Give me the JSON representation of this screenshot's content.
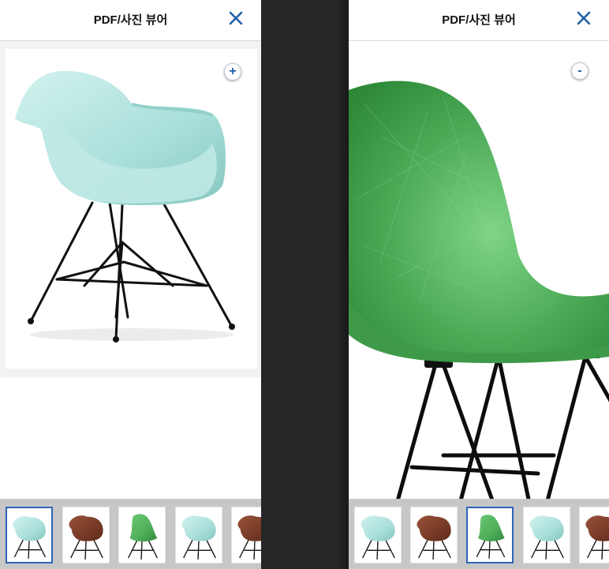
{
  "left_panel": {
    "title": "PDF/사진 뷰어",
    "zoom_label": "+",
    "thumbnails": [
      {
        "chair": "aqua-armchair",
        "selected": true
      },
      {
        "chair": "brown-armchair",
        "selected": false
      },
      {
        "chair": "green-side-chair",
        "selected": false
      },
      {
        "chair": "aqua-armchair",
        "selected": false
      },
      {
        "chair": "brown-armchair",
        "selected": false
      }
    ]
  },
  "right_panel": {
    "title": "PDF/사진 뷰어",
    "zoom_label": "-",
    "thumbnails": [
      {
        "chair": "aqua-armchair",
        "selected": false
      },
      {
        "chair": "brown-armchair",
        "selected": false
      },
      {
        "chair": "green-side-chair",
        "selected": true
      },
      {
        "chair": "aqua-armchair",
        "selected": false
      },
      {
        "chair": "brown-armchair",
        "selected": false
      }
    ]
  },
  "colors": {
    "accent": "#2d63b8",
    "aqua_shell": "#a9dfda",
    "green_shell": "#4fae5a",
    "brown_shell": "#7a3b27",
    "base": "#111111"
  },
  "icons": {
    "close": "close-icon",
    "zoom_in": "zoom-in-icon",
    "zoom_out": "zoom-out-icon"
  }
}
